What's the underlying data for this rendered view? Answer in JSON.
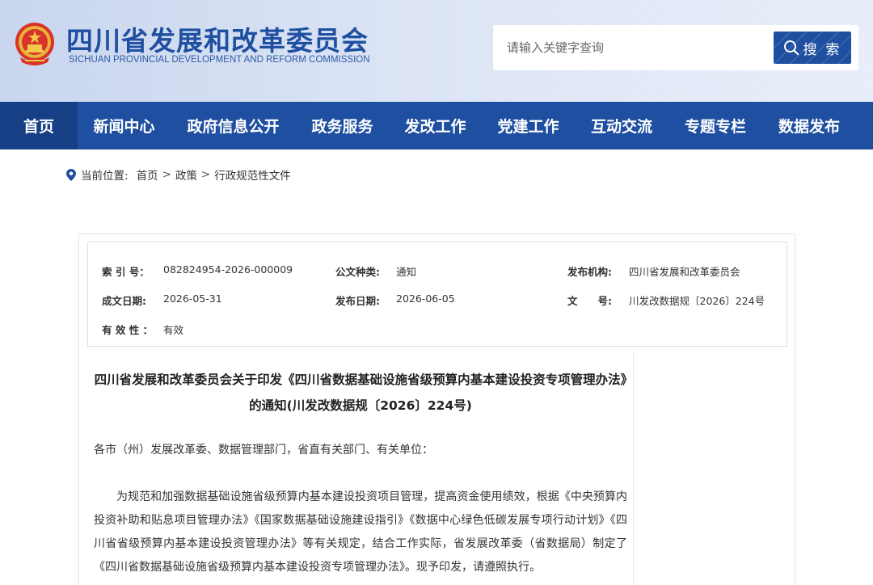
{
  "header": {
    "title": "四川省发展和改革委员会",
    "subtitle": "SICHUAN PROVINCIAL DEVELOPMENT AND REFORM COMMISSION",
    "emblem_icon": "national-emblem-icon",
    "search": {
      "placeholder": "请输入关键字查询",
      "button_label": "搜 索",
      "button_icon": "search-icon"
    },
    "colors": {
      "brand": "#1f4fa0",
      "nav_active": "#173f86"
    }
  },
  "nav": {
    "items": [
      {
        "label": "首页",
        "active": true
      },
      {
        "label": "新闻中心"
      },
      {
        "label": "政府信息公开"
      },
      {
        "label": "政务服务"
      },
      {
        "label": "发改工作"
      },
      {
        "label": "党建工作"
      },
      {
        "label": "互动交流"
      },
      {
        "label": "专题专栏"
      },
      {
        "label": "数据发布"
      }
    ]
  },
  "breadcrumb": {
    "prefix": "当前位置:",
    "items": [
      "首页",
      "政策",
      "行政规范性文件"
    ],
    "separator": ">"
  },
  "meta": {
    "index_label": "索 引 号：",
    "index_value": "082824954-2026-000009",
    "doc_type_label": "公文种类:",
    "doc_type_value": "通知",
    "issuer_label": "发布机构:",
    "issuer_value": "四川省发展和改革委员会",
    "written_date_label": "成文日期:",
    "written_date_value": "2026-05-31",
    "publish_date_label": "发布日期:",
    "publish_date_value": "2026-06-05",
    "doc_no_label": "文　　号:",
    "doc_no_value": "川发改数据规〔2026〕224号",
    "validity_label": "有 效 性 ：",
    "validity_value": "有效"
  },
  "article": {
    "title": "四川省发展和改革委员会关于印发《四川省数据基础设施省级预算内基本建设投资专项管理办法》的通知(川发改数据规〔2026〕224号)",
    "greeting": "各市（州）发展改革委、数据管理部门，省直有关部门、有关单位：",
    "paragraph": "为规范和加强数据基础设施省级预算内基本建设投资项目管理，提高资金使用绩效，根据《中央预算内投资补助和贴息项目管理办法》《国家数据基础设施建设指引》《数据中心绿色低碳发展专项行动计划》《四川省省级预算内基本建设投资管理办法》等有关规定，结合工作实际，省发展改革委（省数据局）制定了《四川省数据基础设施省级预算内基本建设投资专项管理办法》。现予印发，请遵照执行。"
  }
}
